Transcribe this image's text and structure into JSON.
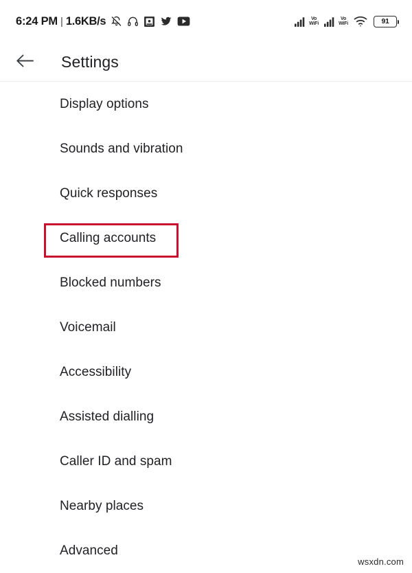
{
  "status_bar": {
    "clock": "6:24 PM",
    "separator": "|",
    "network_speed": "1.6KB/s",
    "left_icons": [
      "notifications-off-icon",
      "headphones-icon",
      "app-screenshot-icon",
      "twitter-icon",
      "youtube-icon"
    ],
    "right_icons": [
      "signal-bars-icon",
      "vowifi-label",
      "signal-bars-icon",
      "vowifi-label",
      "wifi-icon",
      "battery-icon"
    ],
    "vowifi_line1": "Vo",
    "vowifi_line2": "WiFi",
    "battery_level": "91"
  },
  "app_bar": {
    "back_icon": "arrow-left-icon",
    "title": "Settings"
  },
  "settings": {
    "items": [
      {
        "label": "Display options",
        "highlighted": false
      },
      {
        "label": "Sounds and vibration",
        "highlighted": false
      },
      {
        "label": "Quick responses",
        "highlighted": false
      },
      {
        "label": "Calling accounts",
        "highlighted": true
      },
      {
        "label": "Blocked numbers",
        "highlighted": false
      },
      {
        "label": "Voicemail",
        "highlighted": false
      },
      {
        "label": "Accessibility",
        "highlighted": false
      },
      {
        "label": "Assisted dialling",
        "highlighted": false
      },
      {
        "label": "Caller ID and spam",
        "highlighted": false
      },
      {
        "label": "Nearby places",
        "highlighted": false
      },
      {
        "label": "Advanced",
        "highlighted": false
      }
    ]
  },
  "annotation": {
    "highlight_color": "#c8102e",
    "target_label": "Calling accounts"
  },
  "watermark": {
    "text": "wsxdn.com"
  }
}
